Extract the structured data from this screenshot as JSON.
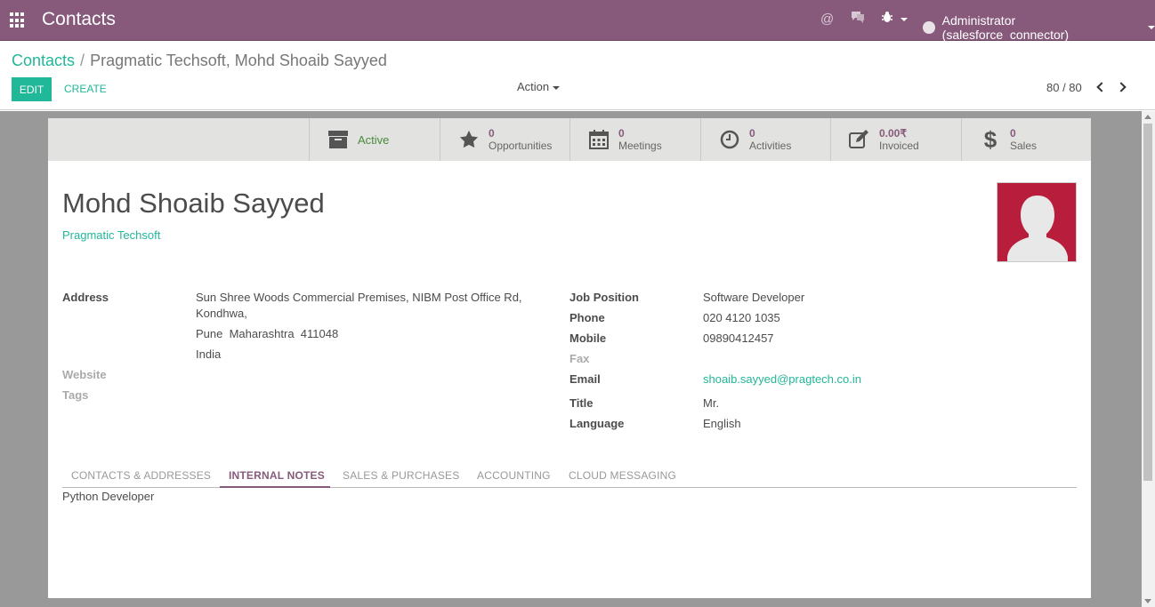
{
  "navbar": {
    "app_title": "Contacts",
    "user_label": "Administrator (salesforce_connector)",
    "icons": [
      "apps-icon",
      "mention-icon",
      "chat-icon",
      "bug-icon"
    ]
  },
  "breadcrumb": {
    "parent": "Contacts",
    "separator": "/",
    "current": "Pragmatic Techsoft, Mohd Shoaib Sayyed"
  },
  "toolbar": {
    "edit_label": "EDIT",
    "create_label": "CREATE",
    "action_label": "Action",
    "pager_text": "80 / 80"
  },
  "smart_buttons": [
    {
      "icon": "archive-icon",
      "value": "",
      "label": "Active"
    },
    {
      "icon": "star-icon",
      "value": "0",
      "label": "Opportunities"
    },
    {
      "icon": "calendar-icon",
      "value": "0",
      "label": "Meetings"
    },
    {
      "icon": "clock-icon",
      "value": "0",
      "label": "Activities"
    },
    {
      "icon": "edit-icon",
      "value": "0.00₹",
      "label": "Invoiced"
    },
    {
      "icon": "dollar-icon",
      "value": "0",
      "label": "Sales"
    }
  ],
  "partner": {
    "name": "Mohd Shoaib Sayyed",
    "company": "Pragmatic Techsoft"
  },
  "left_fields": {
    "address_label": "Address",
    "address_line1": "Sun Shree Woods Commercial Premises, NIBM Post Office Rd,",
    "address_line2": "Kondhwa,",
    "address_line3": "Pune  Maharashtra  411048",
    "address_country": "India",
    "website_label": "Website",
    "tags_label": "Tags"
  },
  "right_fields": {
    "job_label": "Job Position",
    "job_value": "Software Developer",
    "phone_label": "Phone",
    "phone_value": "020 4120 1035",
    "mobile_label": "Mobile",
    "mobile_value": "09890412457",
    "fax_label": "Fax",
    "email_label": "Email",
    "email_value": "shoaib.sayyed@pragtech.co.in",
    "title_label": "Title",
    "title_value": "Mr.",
    "language_label": "Language",
    "language_value": "English"
  },
  "tabs": [
    {
      "label": "CONTACTS & ADDRESSES",
      "active": false
    },
    {
      "label": "INTERNAL NOTES",
      "active": true
    },
    {
      "label": "SALES & PURCHASES",
      "active": false
    },
    {
      "label": "ACCOUNTING",
      "active": false
    },
    {
      "label": "CLOUD MESSAGING",
      "active": false
    }
  ],
  "notes": "Python Developer",
  "colors": {
    "brand": "#875a7b",
    "accent": "#21b799",
    "avatar_bg": "#b91d3c"
  }
}
